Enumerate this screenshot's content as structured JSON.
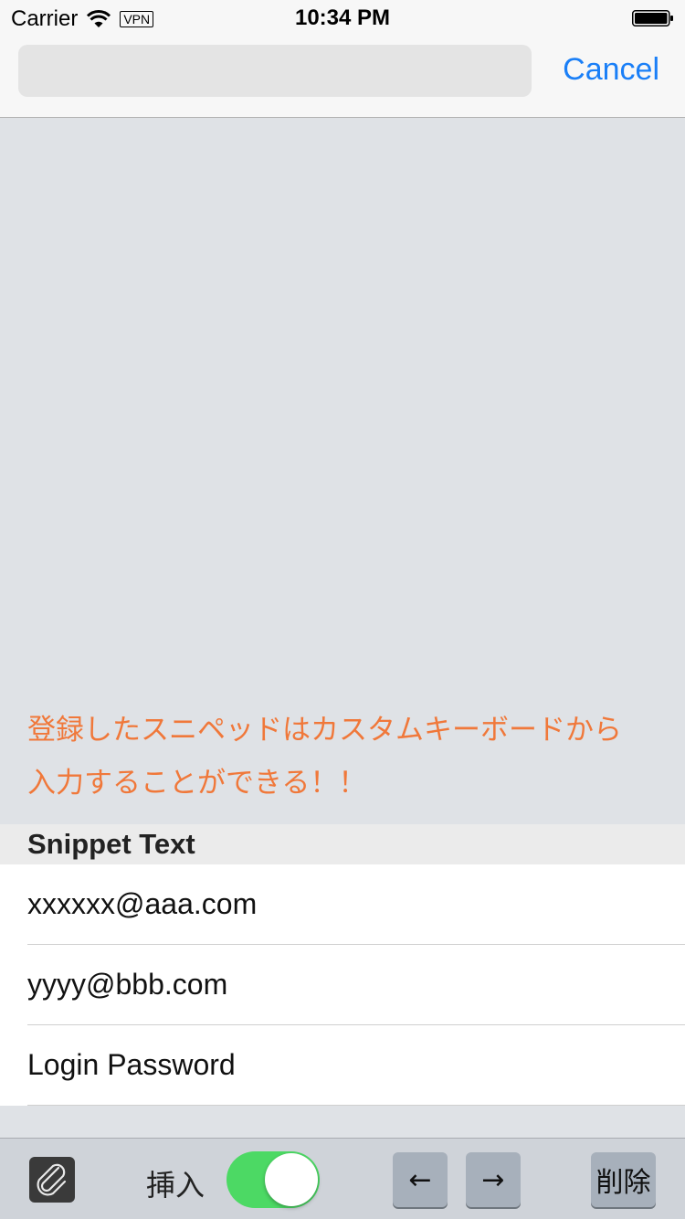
{
  "status_bar": {
    "carrier": "Carrier",
    "vpn": "VPN",
    "time": "10:34 PM"
  },
  "search": {
    "value": "",
    "placeholder": "",
    "cancel_label": "Cancel"
  },
  "hint": {
    "text": "登録したスニペッドはカスタムキーボードから\n入力することができる！！"
  },
  "snippets": {
    "section_title": "Snippet Text",
    "items": [
      "xxxxxx@aaa.com",
      "yyyy@bbb.com",
      "Login Password"
    ]
  },
  "toolbar": {
    "insert_label": "挿入",
    "insert_on": true,
    "left_arrow": "←",
    "right_arrow": "→",
    "delete_label": "削除"
  },
  "colors": {
    "accent": "#1a7ff7",
    "hint": "#f0783a",
    "toggle_on": "#4cd964"
  },
  "icons": {
    "wifi": "wifi-icon",
    "battery": "battery-icon",
    "attach": "paperclip-icon"
  }
}
